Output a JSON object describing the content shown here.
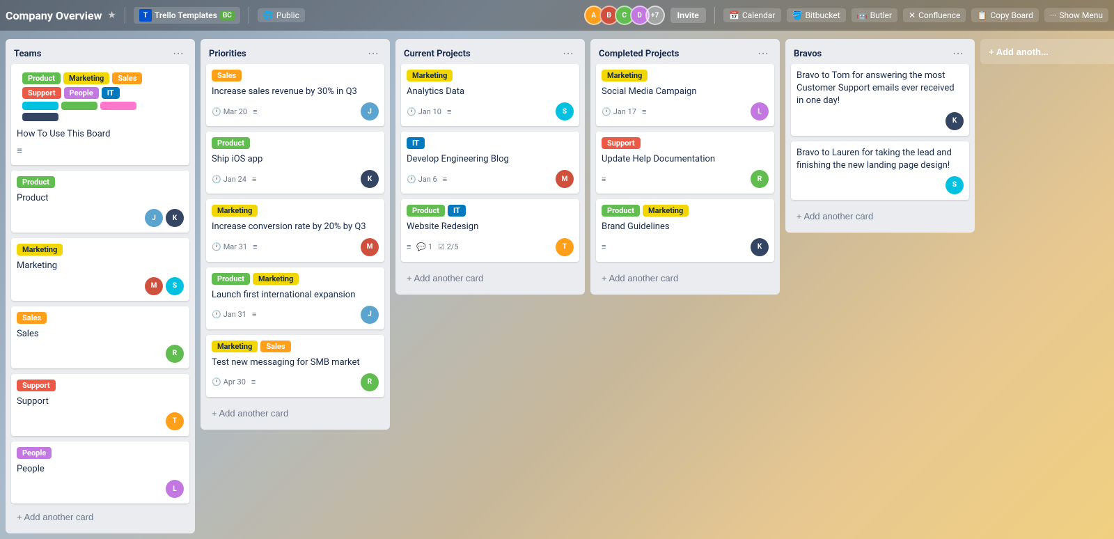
{
  "header": {
    "title": "Company Overview",
    "workspace": "Trello Templates",
    "workspace_initials": "BC",
    "visibility": "Public",
    "invite_label": "Invite",
    "avatar_count": "+7",
    "tools": [
      "Calendar",
      "Bitbucket",
      "Butler",
      "Confluence",
      "Copy Board"
    ],
    "show_menu": "Show Menu",
    "add_another": "+ Add anoth"
  },
  "columns": [
    {
      "id": "teams",
      "title": "Teams",
      "cards": [
        {
          "type": "labels-display",
          "row1": [
            "Product",
            "Marketing",
            "Sales"
          ],
          "row2": [
            "Support",
            "People",
            "IT"
          ],
          "row3_colors": [
            "#00c2e0",
            "#61bd4f",
            "#ff78cb"
          ],
          "row4_colors": [
            "#344563"
          ],
          "subtitle": "How To Use This Board",
          "has_menu": true
        },
        {
          "type": "regular",
          "labels": [
            {
              "text": "Product",
              "color": "label-green"
            }
          ],
          "title": "Product",
          "avatars": [
            "av1",
            "av7"
          ],
          "has_menu": true
        },
        {
          "type": "regular",
          "labels": [
            {
              "text": "Marketing",
              "color": "label-yellow"
            }
          ],
          "title": "Marketing",
          "avatars": [
            "av2",
            "av3"
          ],
          "has_menu": true
        },
        {
          "type": "regular",
          "labels": [
            {
              "text": "Sales",
              "color": "label-orange"
            }
          ],
          "title": "Sales",
          "avatars": [
            "av4"
          ],
          "has_menu": true
        },
        {
          "type": "regular",
          "labels": [
            {
              "text": "Support",
              "color": "label-red"
            }
          ],
          "title": "Support",
          "avatars": [
            "av5"
          ],
          "has_menu": true
        },
        {
          "type": "regular",
          "labels": [
            {
              "text": "People",
              "color": "label-purple"
            }
          ],
          "title": "People",
          "avatars": [
            "av6"
          ],
          "has_menu": true
        }
      ],
      "add_card": "+ Add another card"
    },
    {
      "id": "priorities",
      "title": "Priorities",
      "cards": [
        {
          "type": "regular",
          "labels": [
            {
              "text": "Sales",
              "color": "label-orange"
            }
          ],
          "title": "Increase sales revenue by 30% in Q3",
          "date": "Mar 20",
          "has_desc": true,
          "avatars": [
            "av1"
          ]
        },
        {
          "type": "regular",
          "labels": [
            {
              "text": "Product",
              "color": "label-green"
            }
          ],
          "title": "Ship iOS app",
          "date": "Jan 24",
          "has_desc": true,
          "avatars": [
            "av7"
          ]
        },
        {
          "type": "regular",
          "labels": [
            {
              "text": "Marketing",
              "color": "label-yellow"
            }
          ],
          "title": "Increase conversion rate by 20% by Q3",
          "date": "Mar 31",
          "has_desc": true,
          "avatars": [
            "av2"
          ]
        },
        {
          "type": "regular",
          "labels": [
            {
              "text": "Product",
              "color": "label-green"
            },
            {
              "text": "Marketing",
              "color": "label-yellow"
            }
          ],
          "title": "Launch first international expansion",
          "date": "Jan 31",
          "has_desc": true,
          "avatars": [
            "av1"
          ]
        },
        {
          "type": "regular",
          "labels": [
            {
              "text": "Marketing",
              "color": "label-yellow"
            },
            {
              "text": "Sales",
              "color": "label-orange"
            }
          ],
          "title": "Test new messaging for SMB market",
          "date": "Apr 30",
          "has_desc": true,
          "avatars": [
            "av4"
          ]
        }
      ],
      "add_card": "+ Add another card"
    },
    {
      "id": "current-projects",
      "title": "Current Projects",
      "cards": [
        {
          "type": "regular",
          "labels": [
            {
              "text": "Marketing",
              "color": "label-yellow"
            }
          ],
          "title": "Analytics Data",
          "date": "Jan 10",
          "has_desc": true,
          "avatars": [
            "av3"
          ]
        },
        {
          "type": "regular",
          "labels": [
            {
              "text": "IT",
              "color": "label-blue"
            }
          ],
          "title": "Develop Engineering Blog",
          "date": "Jan 6",
          "has_desc": true,
          "avatars": [
            "av2"
          ]
        },
        {
          "type": "regular",
          "labels": [
            {
              "text": "Product",
              "color": "label-green"
            },
            {
              "text": "IT",
              "color": "label-blue"
            }
          ],
          "title": "Website Redesign",
          "has_desc": true,
          "comments": "1",
          "checklist": "2/5",
          "avatars": [
            "av5"
          ]
        }
      ],
      "add_card": "+ Add another card"
    },
    {
      "id": "completed-projects",
      "title": "Completed Projects",
      "cards": [
        {
          "type": "regular",
          "labels": [
            {
              "text": "Marketing",
              "color": "label-yellow"
            }
          ],
          "title": "Social Media Campaign",
          "date": "Jan 17",
          "has_desc": true,
          "avatars": [
            "av6"
          ]
        },
        {
          "type": "regular",
          "labels": [
            {
              "text": "Support",
              "color": "label-red"
            }
          ],
          "title": "Update Help Documentation",
          "has_desc": true,
          "avatars": [
            "av4"
          ]
        },
        {
          "type": "regular",
          "labels": [
            {
              "text": "Product",
              "color": "label-green"
            },
            {
              "text": "Marketing",
              "color": "label-yellow"
            }
          ],
          "title": "Brand Guidelines",
          "has_desc": true,
          "avatars": [
            "av7"
          ]
        }
      ],
      "add_card": "+ Add another card"
    },
    {
      "id": "bravos",
      "title": "Bravos",
      "cards": [
        {
          "type": "text-only",
          "title": "Bravo to Tom for answering the most Customer Support emails ever received in one day!",
          "avatars": [
            "av7"
          ]
        },
        {
          "type": "text-only",
          "title": "Bravo to Lauren for taking the lead and finishing the new landing page design!",
          "avatars": [
            "av3"
          ]
        }
      ],
      "add_card": "+ Add another card"
    }
  ]
}
